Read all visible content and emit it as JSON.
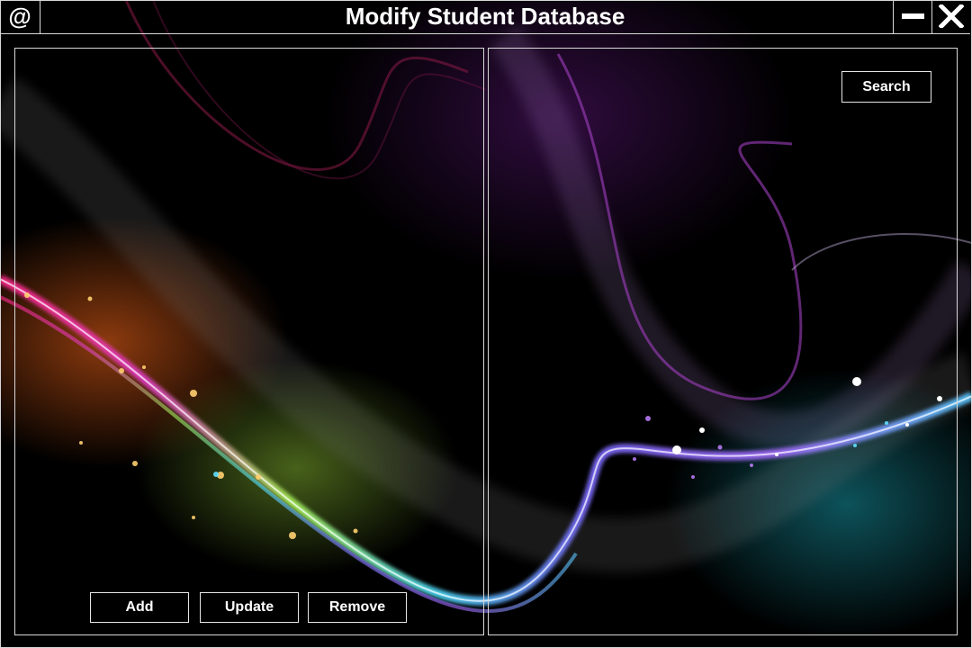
{
  "window": {
    "title": "Modify Student Database",
    "app_icon": "@",
    "icons": {
      "app": "at-sign-icon",
      "minimize": "minimize-icon",
      "close": "close-icon"
    }
  },
  "right_panel": {
    "search_label": "Search"
  },
  "left_panel": {
    "add_label": "Add",
    "update_label": "Update",
    "remove_label": "Remove"
  },
  "colors": {
    "background": "#000000",
    "border": "#d8d8d8",
    "text": "#ffffff"
  }
}
